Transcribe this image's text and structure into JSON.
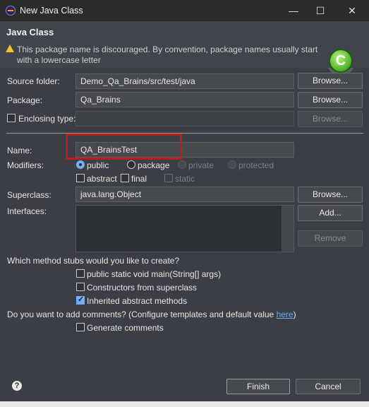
{
  "window": {
    "title": "New Java Class",
    "minimize": "—",
    "maximize": "☐",
    "close": "✕"
  },
  "header": {
    "title": "Java Class",
    "warning": "This package name is discouraged. By convention, package names usually start with a lowercase letter",
    "badge_letter": "C"
  },
  "form": {
    "source_folder": {
      "label": "Source folder:",
      "value": "Demo_Qa_Brains/src/test/java",
      "button": "Browse..."
    },
    "package": {
      "label": "Package:",
      "value": "Qa_Brains",
      "button": "Browse..."
    },
    "enclosing_type": {
      "label": "Enclosing type:",
      "value": "",
      "button": "Browse...",
      "checked": false
    },
    "name": {
      "label": "Name:",
      "value": "QA_BrainsTest"
    },
    "modifiers": {
      "label": "Modifiers:",
      "public": "public",
      "package": "package",
      "private": "private",
      "protected": "protected",
      "abstract": "abstract",
      "final": "final",
      "static": "static"
    },
    "superclass": {
      "label": "Superclass:",
      "value": "java.lang.Object",
      "button": "Browse..."
    },
    "interfaces": {
      "label": "Interfaces:",
      "add": "Add...",
      "remove": "Remove"
    }
  },
  "stubs": {
    "question": "Which method stubs would you like to create?",
    "main": "public static void main(String[] args)",
    "constructors": "Constructors from superclass",
    "inherited": "Inherited abstract methods"
  },
  "comments": {
    "question": "Do you want to add comments? (Configure templates and default value ",
    "link": "here",
    "question_end": ")",
    "generate": "Generate comments"
  },
  "footer": {
    "finish": "Finish",
    "cancel": "Cancel",
    "help": "?"
  },
  "colors": {
    "accent": "#6fb1f2",
    "highlight": "#c01a1a",
    "warning": "#f2c12e"
  }
}
